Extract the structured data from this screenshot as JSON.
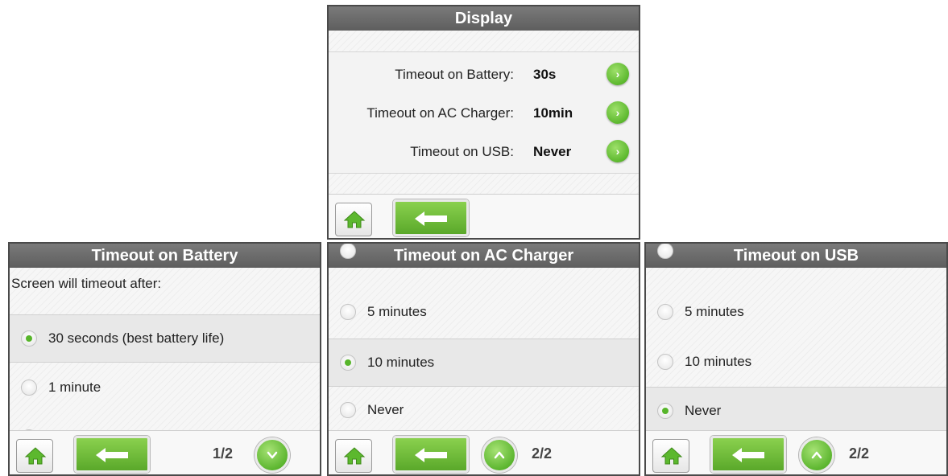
{
  "display": {
    "title": "Display",
    "rows": [
      {
        "label": "Timeout on Battery:",
        "value": "30s"
      },
      {
        "label": "Timeout on AC Charger:",
        "value": "10min"
      },
      {
        "label": "Timeout on USB:",
        "value": "Never"
      }
    ]
  },
  "battery": {
    "title": "Timeout on Battery",
    "prompt": "Screen will timeout after:",
    "options": [
      {
        "label": "30 seconds (best battery life)",
        "selected": true
      },
      {
        "label": "1 minute",
        "selected": false
      }
    ],
    "page": "1/2"
  },
  "ac_charger": {
    "title": "Timeout on AC Charger",
    "options": [
      {
        "label": "5 minutes",
        "selected": false
      },
      {
        "label": "10 minutes",
        "selected": true
      },
      {
        "label": "Never",
        "selected": false
      }
    ],
    "page": "2/2"
  },
  "usb": {
    "title": "Timeout on USB",
    "options": [
      {
        "label": "5 minutes",
        "selected": false
      },
      {
        "label": "10 minutes",
        "selected": false
      },
      {
        "label": "Never",
        "selected": true
      }
    ],
    "page": "2/2"
  },
  "colors": {
    "accent_green": "#5cb82e",
    "titlebar": "#6a6a6a",
    "border": "#4a4a4a"
  },
  "icons": {
    "home": "home-icon",
    "back": "arrow-left-icon",
    "forward": "chevron-right-icon",
    "page_down": "chevron-down-icon",
    "page_up": "chevron-up-icon"
  }
}
